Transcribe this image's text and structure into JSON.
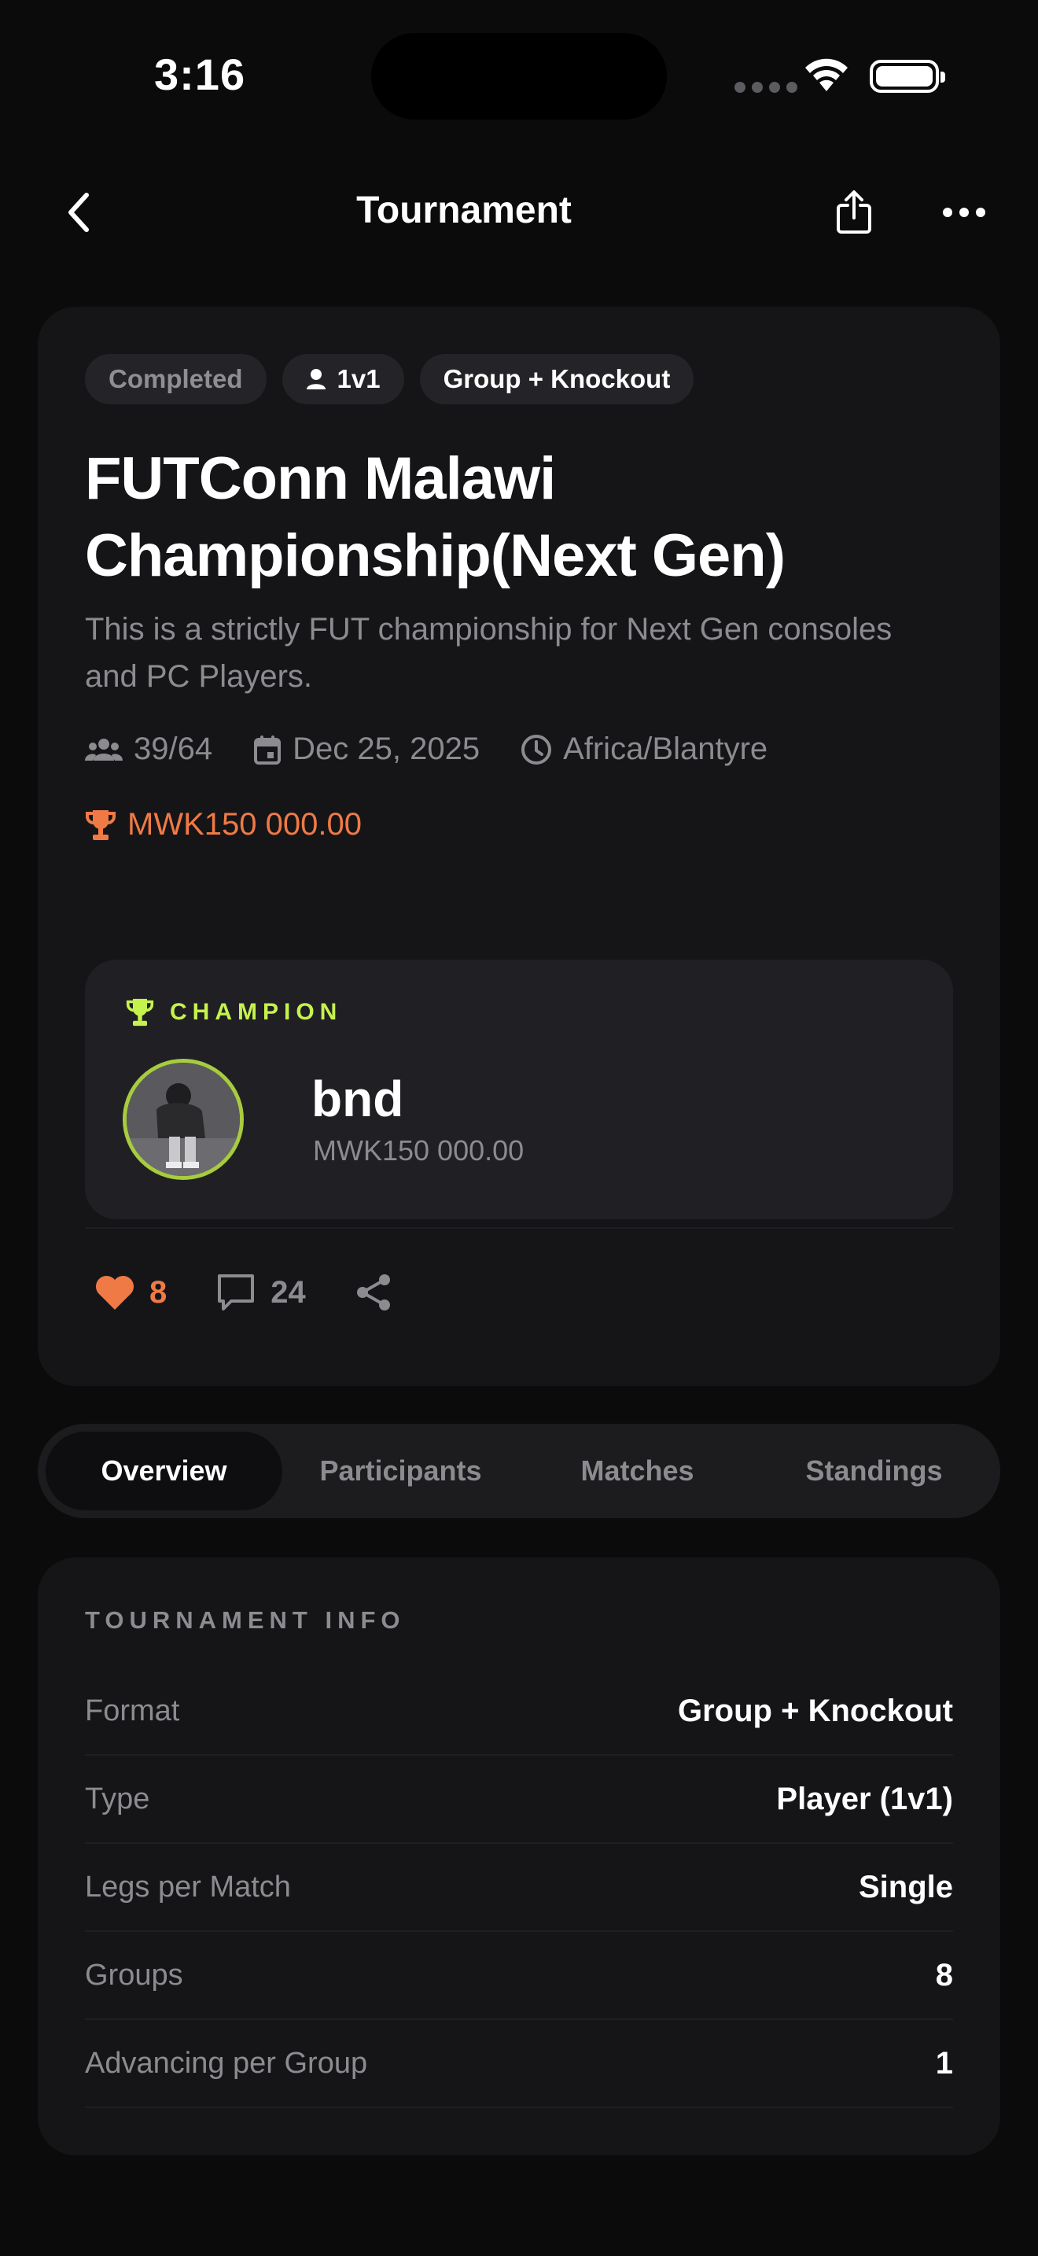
{
  "status_bar": {
    "time": "3:16"
  },
  "nav": {
    "title": "Tournament"
  },
  "tournament": {
    "chips": {
      "status": "Completed",
      "mode": "1v1",
      "format": "Group + Knockout"
    },
    "title_line1": "FUTConn Malawi",
    "title_line2": "Championship(Next Gen)",
    "description": "This is a strictly FUT championship for Next Gen consoles and PC Players.",
    "participants": "39/64",
    "date": "Dec 25, 2025",
    "timezone": "Africa/Blantyre",
    "prize": "MWK150 000.00"
  },
  "champion": {
    "label": "CHAMPION",
    "name": "bnd",
    "prize": "MWK150 000.00"
  },
  "actions": {
    "likes": "8",
    "comments": "24"
  },
  "tabs": [
    "Overview",
    "Participants",
    "Matches",
    "Standings"
  ],
  "info": {
    "heading": "TOURNAMENT INFO",
    "rows": [
      {
        "key": "Format",
        "value": "Group + Knockout"
      },
      {
        "key": "Type",
        "value": "Player (1v1)"
      },
      {
        "key": "Legs per Match",
        "value": "Single"
      },
      {
        "key": "Groups",
        "value": "8"
      },
      {
        "key": "Advancing per Group",
        "value": "1"
      }
    ]
  },
  "colors": {
    "accent_orange": "#f07a45",
    "champion_green": "#c6f24e",
    "card_bg": "#151518",
    "page_bg": "#0b0b0c"
  }
}
